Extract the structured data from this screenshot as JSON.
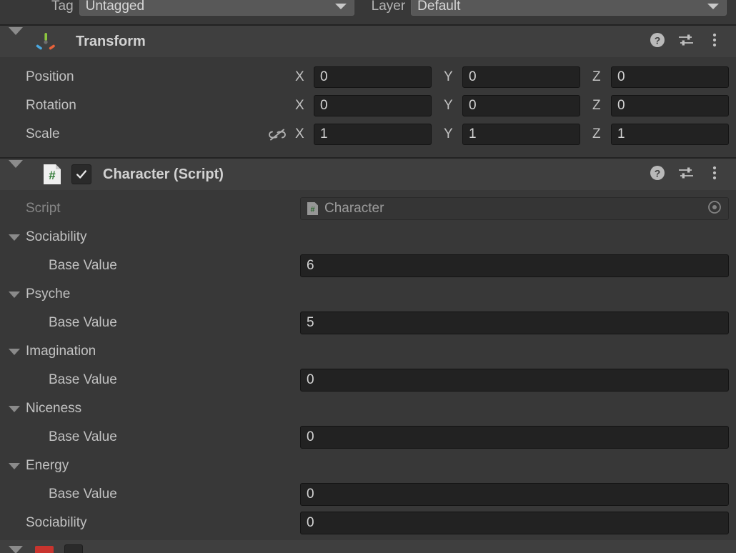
{
  "object_header": {
    "tag": {
      "label": "Tag",
      "value": "Untagged"
    },
    "layer": {
      "label": "Layer",
      "value": "Default"
    }
  },
  "components": [
    {
      "name": "transform",
      "title": "Transform",
      "icon": "transform-gizmo-icon",
      "rows": [
        {
          "label": "Position",
          "axes": [
            {
              "axis": "X",
              "value": "0"
            },
            {
              "axis": "Y",
              "value": "0"
            },
            {
              "axis": "Z",
              "value": "0"
            }
          ]
        },
        {
          "label": "Rotation",
          "axes": [
            {
              "axis": "X",
              "value": "0"
            },
            {
              "axis": "Y",
              "value": "0"
            },
            {
              "axis": "Z",
              "value": "0"
            }
          ]
        },
        {
          "label": "Scale",
          "constrain_icon": "unlinked-chain-icon",
          "axes": [
            {
              "axis": "X",
              "value": "1"
            },
            {
              "axis": "Y",
              "value": "1"
            },
            {
              "axis": "Z",
              "value": "1"
            }
          ]
        }
      ]
    },
    {
      "name": "character-script",
      "title": "Character (Script)",
      "icon": "cs-script-icon",
      "enabled": true,
      "script_row": {
        "label": "Script",
        "value": "Character"
      },
      "properties": [
        {
          "kind": "foldout",
          "label": "Sociability"
        },
        {
          "kind": "field",
          "label": "Base Value",
          "value": "6"
        },
        {
          "kind": "foldout",
          "label": "Psyche"
        },
        {
          "kind": "field",
          "label": "Base Value",
          "value": "5"
        },
        {
          "kind": "foldout",
          "label": "Imagination"
        },
        {
          "kind": "field",
          "label": "Base Value",
          "value": "0"
        },
        {
          "kind": "foldout",
          "label": "Niceness"
        },
        {
          "kind": "field",
          "label": "Base Value",
          "value": "0"
        },
        {
          "kind": "foldout",
          "label": "Energy"
        },
        {
          "kind": "field",
          "label": "Base Value",
          "value": "0"
        },
        {
          "kind": "field_top",
          "label": "Sociability",
          "value": "0"
        }
      ]
    }
  ],
  "header_icons": {
    "help": "help-icon",
    "preset": "preset-icon",
    "menu": "kebab-menu-icon"
  },
  "colors": {
    "panel_bg": "#383838",
    "header_bg": "#3f3f3f",
    "field_bg": "#222222",
    "separator": "#232323",
    "text": "#c4c4c4",
    "text_dim": "#868686",
    "script_green": "#2f7a34",
    "bottom_component_accent": "#c8342e"
  }
}
